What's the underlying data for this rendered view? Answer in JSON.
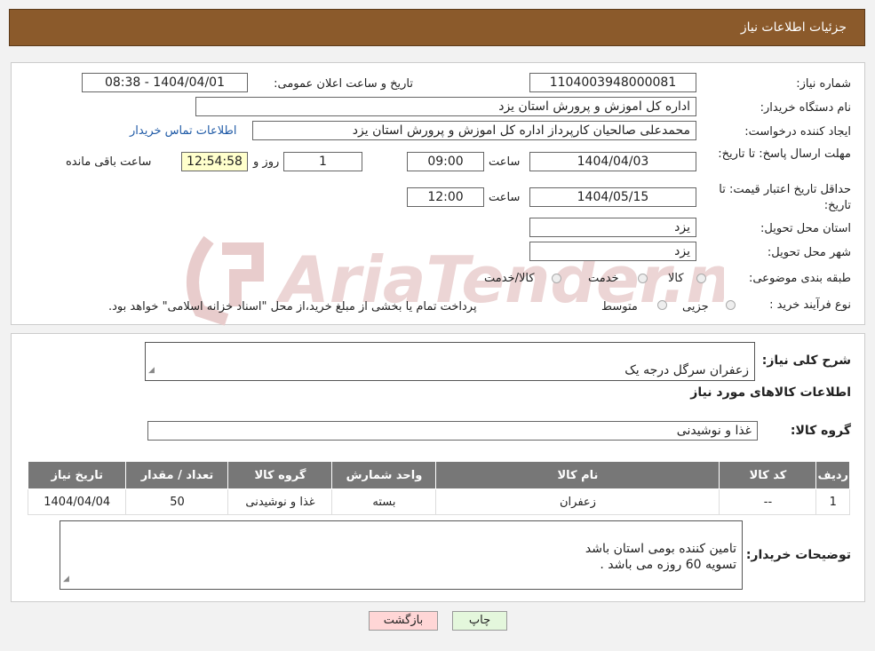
{
  "header": {
    "title": "جزئیات اطلاعات نیاز"
  },
  "watermark": {
    "text": "AriaTender.neT"
  },
  "form": {
    "need_number_label": "شماره نیاز:",
    "need_number": "1104003948000081",
    "announce_label": "تاریخ و ساعت اعلان عمومی:",
    "announce_value": "1404/04/01 - 08:38",
    "buyer_org_label": "نام دستگاه خریدار:",
    "buyer_org": "اداره کل اموزش و پرورش استان یزد",
    "requester_label": "ایجاد کننده درخواست:",
    "requester": "محمدعلی صالحیان کارپرداز اداره کل اموزش و پرورش استان یزد",
    "contact_link": "اطلاعات تماس خریدار",
    "deadline_label": "مهلت ارسال پاسخ: تا تاریخ:",
    "deadline_date": "1404/04/03",
    "time_label": "ساعت",
    "deadline_time": "09:00",
    "days_count": "1",
    "days_label": "روز و",
    "remaining_time": "12:54:58",
    "remaining_label": "ساعت باقی مانده",
    "price_valid_label": "حداقل تاریخ اعتبار قیمت: تا تاریخ:",
    "price_valid_date": "1404/05/15",
    "price_valid_time": "12:00",
    "province_label": "استان محل تحویل:",
    "province": "یزد",
    "city_label": "شهر محل تحویل:",
    "city": "یزد",
    "category_label": "طبقه بندی موضوعی:",
    "category_options": [
      "کالا",
      "خدمت",
      "کالا/خدمت"
    ],
    "process_label": "نوع فرآیند خرید :",
    "process_options": [
      "جزیی",
      "متوسط"
    ],
    "process_note": "پرداخت تمام یا بخشی از مبلغ خرید،از محل \"اسناد خزانه اسلامی\" خواهد بود."
  },
  "details": {
    "summary_label": "شرح کلی نیاز:",
    "summary": "زعفران سرگل درجه یک",
    "goods_info_title": "اطلاعات کالاهای مورد نیاز",
    "goods_group_label": "گروه کالا:",
    "goods_group": "غذا و نوشیدنی",
    "table": {
      "headers": [
        "ردیف",
        "کد کالا",
        "نام کالا",
        "واحد شمارش",
        "گروه کالا",
        "تعداد / مقدار",
        "تاریخ نیاز"
      ],
      "rows": [
        [
          "1",
          "--",
          "زعفران",
          "بسته",
          "غذا و نوشیدنی",
          "50",
          "1404/04/04"
        ]
      ]
    },
    "buyer_notes_label": "توضیحات خریدار:",
    "buyer_notes": "تامین کننده بومی استان باشد\nتسویه 60 روزه می باشد ."
  },
  "buttons": {
    "print": "چاپ",
    "back": "بازگشت"
  },
  "colors": {
    "header_bg": "#8b5a2b",
    "table_header_bg": "#777777",
    "back_button_bg": "#ffd6d6",
    "print_button_bg": "#e4f7dc",
    "timer_bg": "#ffffcc",
    "watermark": "#e6c9c9"
  }
}
